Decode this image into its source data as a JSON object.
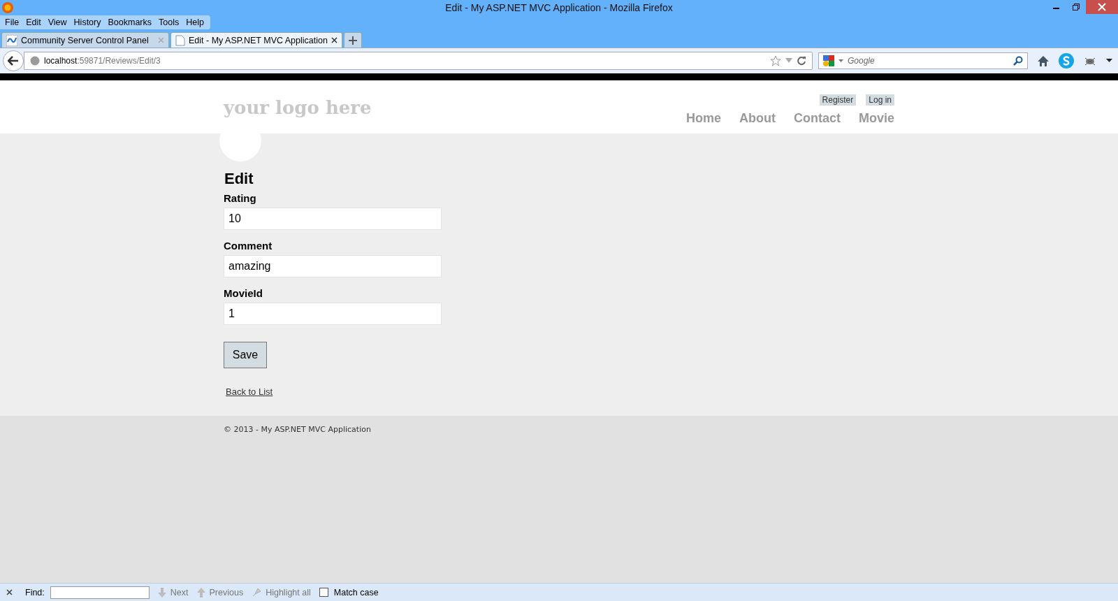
{
  "window": {
    "title": "Edit - My ASP.NET MVC Application - Mozilla Firefox"
  },
  "menu": [
    "File",
    "Edit",
    "View",
    "History",
    "Bookmarks",
    "Tools",
    "Help"
  ],
  "tabs": [
    {
      "label": "Community Server Control Panel",
      "selected": false
    },
    {
      "label": "Edit - My ASP.NET MVC Application",
      "selected": true
    }
  ],
  "address": {
    "host": "localhost",
    "path": ":59871/Reviews/Edit/3"
  },
  "search": {
    "placeholder": "Google"
  },
  "site": {
    "logo": "your logo here",
    "account_links": [
      "Register",
      "Log in"
    ],
    "nav": [
      "Home",
      "About",
      "Contact",
      "Movie"
    ]
  },
  "form": {
    "heading": "Edit",
    "fields": [
      {
        "label": "Rating",
        "value": "10"
      },
      {
        "label": "Comment",
        "value": "amazing"
      },
      {
        "label": "MovieId",
        "value": "1"
      }
    ],
    "submit": "Save",
    "back_link": "Back to List"
  },
  "footer": "© 2013 - My ASP.NET MVC Application",
  "find_bar": {
    "label": "Find:",
    "next": "Next",
    "previous": "Previous",
    "highlight": "Highlight all",
    "match_case": {
      "label": "Match case",
      "checked": false
    }
  }
}
